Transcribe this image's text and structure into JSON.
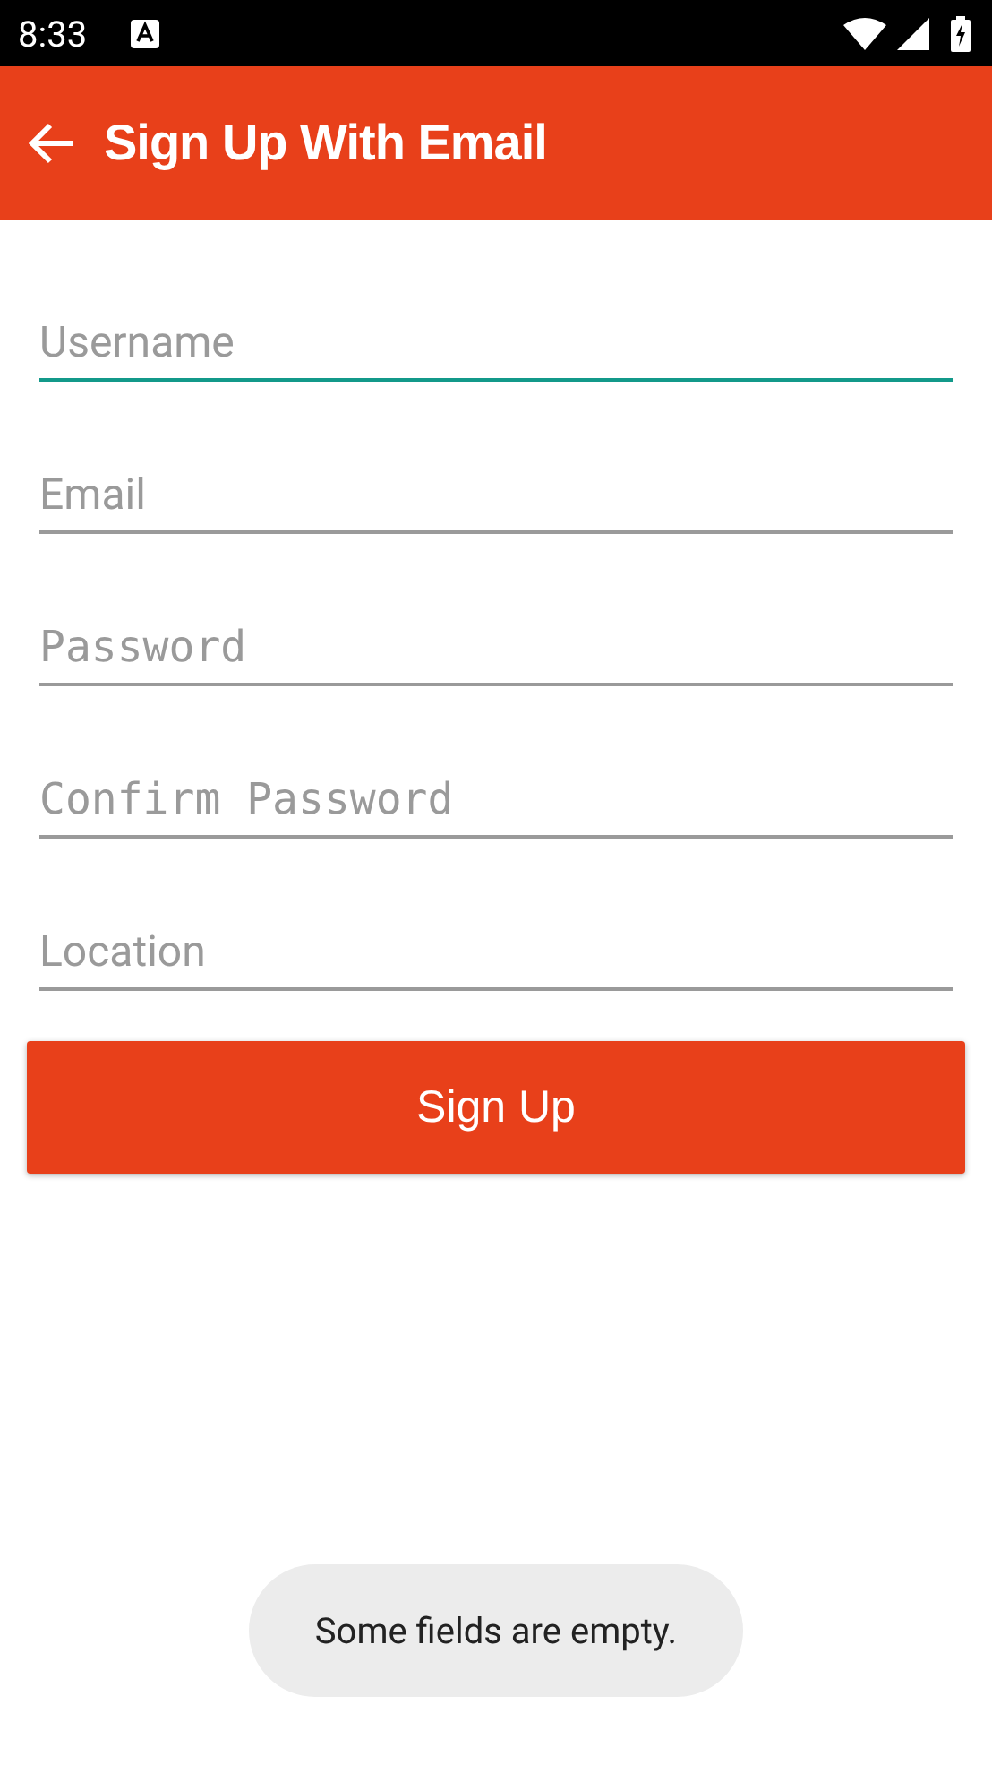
{
  "status_bar": {
    "time": "8:33"
  },
  "app_bar": {
    "title": "Sign Up With Email"
  },
  "fields": [
    {
      "kind": "text",
      "placeholder": "Username",
      "focused": true
    },
    {
      "kind": "text",
      "placeholder": "Email",
      "focused": false
    },
    {
      "kind": "password",
      "placeholder": "Password",
      "focused": false
    },
    {
      "kind": "password",
      "placeholder": "Confirm Password",
      "focused": false
    },
    {
      "kind": "text",
      "placeholder": "Location",
      "focused": false
    }
  ],
  "button": {
    "label": "Sign Up"
  },
  "toast": {
    "text": "Some fields are empty."
  }
}
